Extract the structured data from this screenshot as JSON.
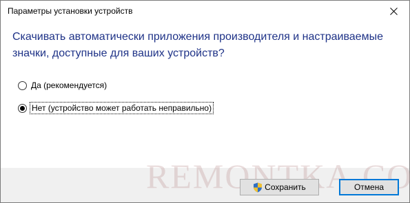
{
  "window": {
    "title": "Параметры установки устройств"
  },
  "question": "Скачивать автоматически приложения производителя и настраиваемые значки, доступные для ваших устройств?",
  "options": [
    {
      "label": "Да (рекомендуется)",
      "checked": false
    },
    {
      "label": "Нет (устройство может работать неправильно)",
      "checked": true
    }
  ],
  "buttons": {
    "save_label": "Сохранить",
    "cancel_label": "Отмена"
  },
  "watermark": "REMONTKA.COM",
  "icons": {
    "close": "close-icon",
    "shield": "uac-shield-icon"
  },
  "colors": {
    "question_text": "#1e3287",
    "footer_bg": "#f0f0f0",
    "default_button_border": "#0078d7",
    "watermark": "#be9696"
  }
}
